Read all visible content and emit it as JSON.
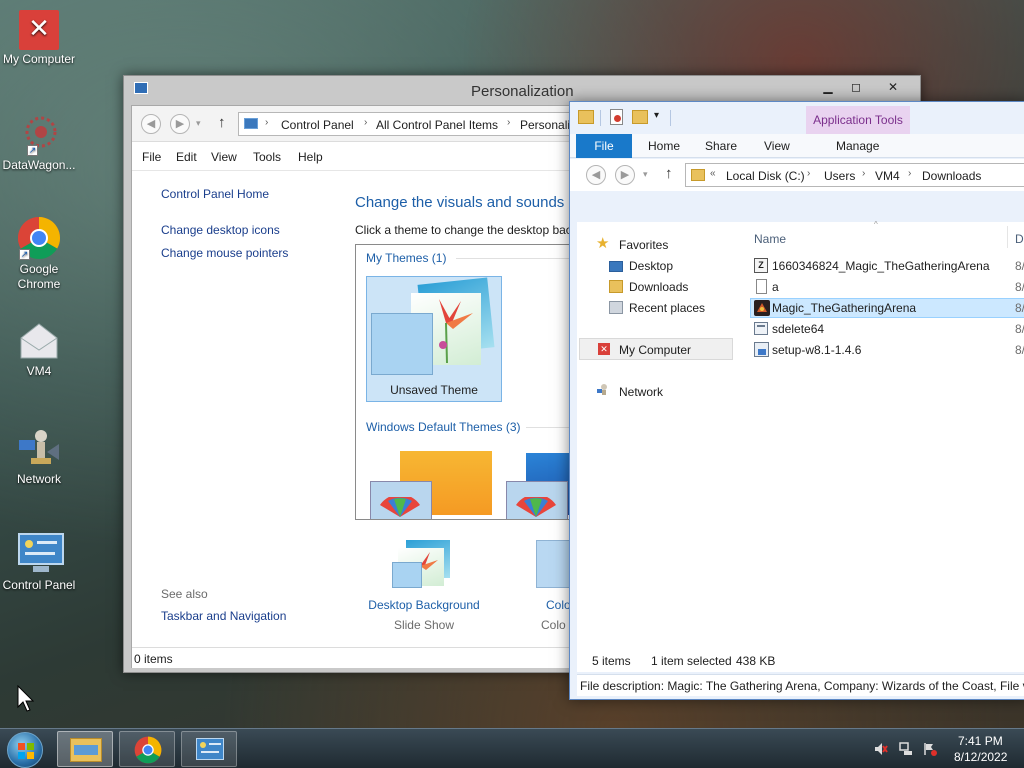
{
  "desktop": {
    "icons": [
      {
        "label": "My Computer",
        "icon": "red-x-computer-icon"
      },
      {
        "label": "DataWagon...",
        "icon": "datawagon-icon"
      },
      {
        "label": "Google Chrome",
        "icon": "chrome-icon"
      },
      {
        "label": "VM4",
        "icon": "envelope-icon"
      },
      {
        "label": "Network",
        "icon": "network-icon"
      },
      {
        "label": "Control Panel",
        "icon": "control-panel-icon"
      }
    ]
  },
  "personalization": {
    "title": "Personalization",
    "breadcrumbs": [
      "Control Panel",
      "All Control Panel Items",
      "Personaliz"
    ],
    "menu": [
      "File",
      "Edit",
      "View",
      "Tools",
      "Help"
    ],
    "sidebar": {
      "home": "Control Panel Home",
      "links": [
        "Change desktop icons",
        "Change mouse pointers"
      ],
      "see_also": "See also",
      "see_also_links": [
        "Taskbar and Navigation"
      ]
    },
    "heading": "Change the visuals and sounds",
    "subheading": "Click a theme to change the desktop bac",
    "my_themes": "My Themes (1)",
    "unsaved_theme": "Unsaved Theme",
    "default_themes": "Windows Default Themes (3)",
    "bottom_items": [
      {
        "title": "Desktop Background",
        "sub": "Slide Show"
      },
      {
        "title": "Colo",
        "sub": "Colo"
      }
    ],
    "status": "0 items"
  },
  "explorer": {
    "ribbon_context": "Application Tools",
    "tabs": [
      "File",
      "Home",
      "Share",
      "View",
      "Manage"
    ],
    "breadcrumbs": [
      "Local Disk (C:)",
      "Users",
      "VM4",
      "Downloads"
    ],
    "nav": {
      "favorites_label": "Favorites",
      "favorites": [
        "Desktop",
        "Downloads",
        "Recent places"
      ],
      "my_computer": "My Computer",
      "network": "Network"
    },
    "columns": {
      "name": "Name",
      "date": "D"
    },
    "files": [
      {
        "name": "1660346824_Magic_TheGatheringArena",
        "date": "8/",
        "icon": "archive-icon",
        "selected": false
      },
      {
        "name": "a",
        "date": "8/",
        "icon": "file-icon",
        "selected": false
      },
      {
        "name": "Magic_TheGatheringArena",
        "date": "8/",
        "icon": "mtga-app-icon",
        "selected": true
      },
      {
        "name": "sdelete64",
        "date": "8/",
        "icon": "exe-icon",
        "selected": false
      },
      {
        "name": "setup-w8.1-1.4.6",
        "date": "8/",
        "icon": "installer-icon",
        "selected": false
      }
    ],
    "status": {
      "count": "5 items",
      "selected": "1 item selected",
      "size": "438 KB"
    },
    "details": "File description: Magic: The Gathering Arena, Company: Wizards of the Coast, File ve"
  },
  "taskbar": {
    "time": "7:41 PM",
    "date": "8/12/2022"
  }
}
